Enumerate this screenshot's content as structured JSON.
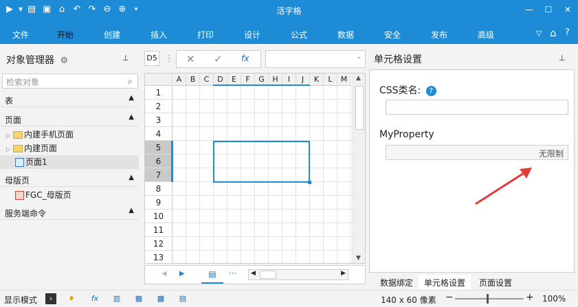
{
  "window": {
    "title": "活字格"
  },
  "ribbon": {
    "tabs": [
      "文件",
      "开始",
      "创建",
      "插入",
      "打印",
      "设计",
      "公式",
      "数据",
      "安全",
      "发布",
      "高级"
    ],
    "active": "开始"
  },
  "object_manager": {
    "title": "对象管理器",
    "search_placeholder": "检索对象",
    "sections": {
      "table": "表",
      "page": "页面",
      "master": "母版页",
      "server": "服务端命令"
    },
    "page_items": [
      "内建手机页面",
      "内建页面",
      "页面1"
    ],
    "master_items": [
      "FGC_母版页"
    ]
  },
  "formula_bar": {
    "cell_ref": "D5",
    "fx": "fx"
  },
  "grid": {
    "columns": [
      "A",
      "B",
      "C",
      "D",
      "E",
      "F",
      "G",
      "H",
      "I",
      "J",
      "K",
      "L",
      "M"
    ],
    "rows": [
      "1",
      "2",
      "3",
      "4",
      "5",
      "6",
      "7",
      "8",
      "9",
      "10",
      "11",
      "12",
      "13"
    ]
  },
  "cell_settings": {
    "title": "单元格设置",
    "css_label": "CSS类名:",
    "myproperty_label": "MyProperty",
    "myproperty_value": "无限制"
  },
  "bottom_tabs": [
    "数据绑定",
    "单元格设置",
    "页面设置"
  ],
  "status": {
    "mode_label": "显示模式",
    "size": "140 x 60 像素",
    "zoom": "100%"
  },
  "colors": {
    "accent": "#1d8bd6",
    "selection": "#1d8bd6",
    "annotation": "#e53935"
  }
}
